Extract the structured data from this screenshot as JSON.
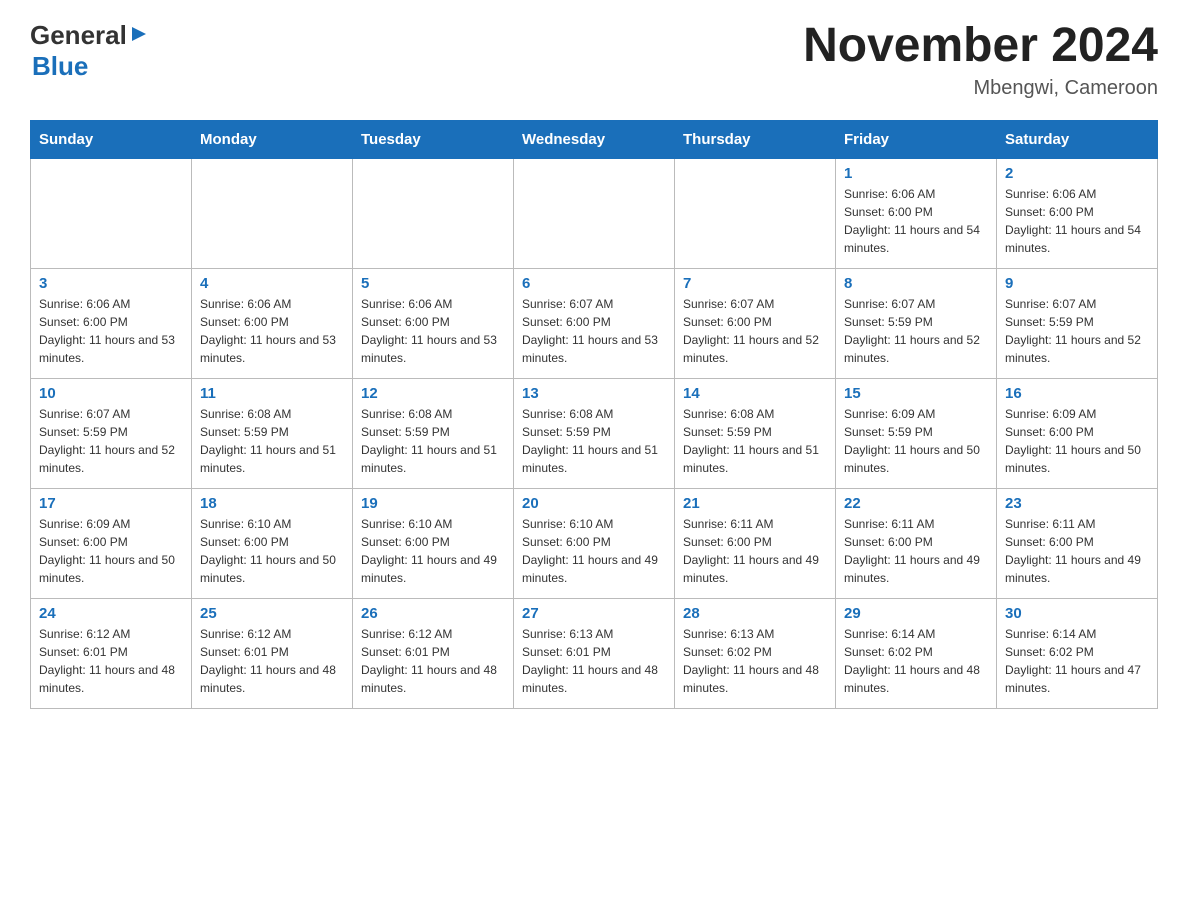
{
  "header": {
    "logo_general": "General",
    "logo_blue": "Blue",
    "month_title": "November 2024",
    "location": "Mbengwi, Cameroon"
  },
  "calendar": {
    "days_of_week": [
      "Sunday",
      "Monday",
      "Tuesday",
      "Wednesday",
      "Thursday",
      "Friday",
      "Saturday"
    ],
    "weeks": [
      [
        {
          "day": "",
          "info": ""
        },
        {
          "day": "",
          "info": ""
        },
        {
          "day": "",
          "info": ""
        },
        {
          "day": "",
          "info": ""
        },
        {
          "day": "",
          "info": ""
        },
        {
          "day": "1",
          "info": "Sunrise: 6:06 AM\nSunset: 6:00 PM\nDaylight: 11 hours and 54 minutes."
        },
        {
          "day": "2",
          "info": "Sunrise: 6:06 AM\nSunset: 6:00 PM\nDaylight: 11 hours and 54 minutes."
        }
      ],
      [
        {
          "day": "3",
          "info": "Sunrise: 6:06 AM\nSunset: 6:00 PM\nDaylight: 11 hours and 53 minutes."
        },
        {
          "day": "4",
          "info": "Sunrise: 6:06 AM\nSunset: 6:00 PM\nDaylight: 11 hours and 53 minutes."
        },
        {
          "day": "5",
          "info": "Sunrise: 6:06 AM\nSunset: 6:00 PM\nDaylight: 11 hours and 53 minutes."
        },
        {
          "day": "6",
          "info": "Sunrise: 6:07 AM\nSunset: 6:00 PM\nDaylight: 11 hours and 53 minutes."
        },
        {
          "day": "7",
          "info": "Sunrise: 6:07 AM\nSunset: 6:00 PM\nDaylight: 11 hours and 52 minutes."
        },
        {
          "day": "8",
          "info": "Sunrise: 6:07 AM\nSunset: 5:59 PM\nDaylight: 11 hours and 52 minutes."
        },
        {
          "day": "9",
          "info": "Sunrise: 6:07 AM\nSunset: 5:59 PM\nDaylight: 11 hours and 52 minutes."
        }
      ],
      [
        {
          "day": "10",
          "info": "Sunrise: 6:07 AM\nSunset: 5:59 PM\nDaylight: 11 hours and 52 minutes."
        },
        {
          "day": "11",
          "info": "Sunrise: 6:08 AM\nSunset: 5:59 PM\nDaylight: 11 hours and 51 minutes."
        },
        {
          "day": "12",
          "info": "Sunrise: 6:08 AM\nSunset: 5:59 PM\nDaylight: 11 hours and 51 minutes."
        },
        {
          "day": "13",
          "info": "Sunrise: 6:08 AM\nSunset: 5:59 PM\nDaylight: 11 hours and 51 minutes."
        },
        {
          "day": "14",
          "info": "Sunrise: 6:08 AM\nSunset: 5:59 PM\nDaylight: 11 hours and 51 minutes."
        },
        {
          "day": "15",
          "info": "Sunrise: 6:09 AM\nSunset: 5:59 PM\nDaylight: 11 hours and 50 minutes."
        },
        {
          "day": "16",
          "info": "Sunrise: 6:09 AM\nSunset: 6:00 PM\nDaylight: 11 hours and 50 minutes."
        }
      ],
      [
        {
          "day": "17",
          "info": "Sunrise: 6:09 AM\nSunset: 6:00 PM\nDaylight: 11 hours and 50 minutes."
        },
        {
          "day": "18",
          "info": "Sunrise: 6:10 AM\nSunset: 6:00 PM\nDaylight: 11 hours and 50 minutes."
        },
        {
          "day": "19",
          "info": "Sunrise: 6:10 AM\nSunset: 6:00 PM\nDaylight: 11 hours and 49 minutes."
        },
        {
          "day": "20",
          "info": "Sunrise: 6:10 AM\nSunset: 6:00 PM\nDaylight: 11 hours and 49 minutes."
        },
        {
          "day": "21",
          "info": "Sunrise: 6:11 AM\nSunset: 6:00 PM\nDaylight: 11 hours and 49 minutes."
        },
        {
          "day": "22",
          "info": "Sunrise: 6:11 AM\nSunset: 6:00 PM\nDaylight: 11 hours and 49 minutes."
        },
        {
          "day": "23",
          "info": "Sunrise: 6:11 AM\nSunset: 6:00 PM\nDaylight: 11 hours and 49 minutes."
        }
      ],
      [
        {
          "day": "24",
          "info": "Sunrise: 6:12 AM\nSunset: 6:01 PM\nDaylight: 11 hours and 48 minutes."
        },
        {
          "day": "25",
          "info": "Sunrise: 6:12 AM\nSunset: 6:01 PM\nDaylight: 11 hours and 48 minutes."
        },
        {
          "day": "26",
          "info": "Sunrise: 6:12 AM\nSunset: 6:01 PM\nDaylight: 11 hours and 48 minutes."
        },
        {
          "day": "27",
          "info": "Sunrise: 6:13 AM\nSunset: 6:01 PM\nDaylight: 11 hours and 48 minutes."
        },
        {
          "day": "28",
          "info": "Sunrise: 6:13 AM\nSunset: 6:02 PM\nDaylight: 11 hours and 48 minutes."
        },
        {
          "day": "29",
          "info": "Sunrise: 6:14 AM\nSunset: 6:02 PM\nDaylight: 11 hours and 48 minutes."
        },
        {
          "day": "30",
          "info": "Sunrise: 6:14 AM\nSunset: 6:02 PM\nDaylight: 11 hours and 47 minutes."
        }
      ]
    ]
  }
}
